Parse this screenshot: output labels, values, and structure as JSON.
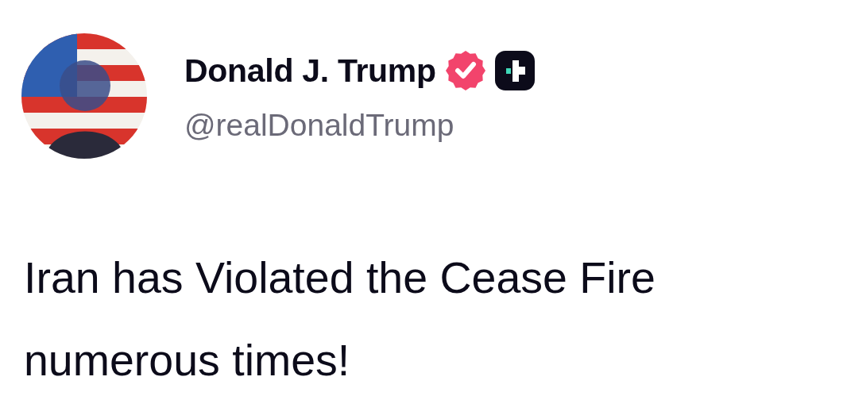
{
  "author": {
    "name": "Donald J. Trump",
    "handle": "@realDonaldTrump",
    "verified": true
  },
  "post": {
    "text": "Iran has Violated the Cease Fire numerous times!"
  }
}
